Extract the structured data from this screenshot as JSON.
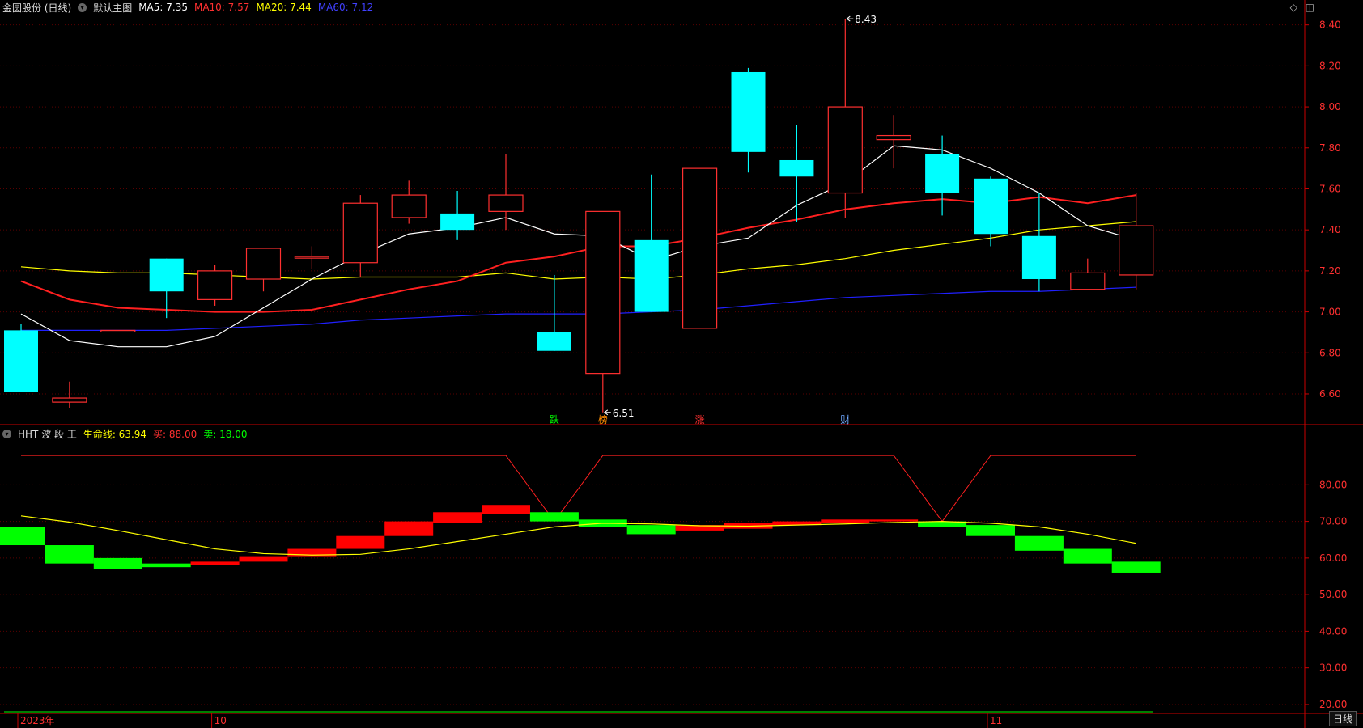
{
  "main_header": {
    "stock": "金圆股份 (日线)",
    "template": "默认主图",
    "ma5": "MA5: 7.35",
    "ma10": "MA10: 7.57",
    "ma20": "MA20: 7.44",
    "ma60": "MA60: 7.12"
  },
  "indicator_header": {
    "name": "HHT 波 段 王",
    "life": "生命线: 63.94",
    "buy": "买: 88.00",
    "sell": "卖: 18.00"
  },
  "colors": {
    "up": "#ff3030",
    "down": "#00ffff",
    "ma5": "#ffffff",
    "ma10": "#ff2020",
    "ma20": "#ffff00",
    "ma60": "#2020ff",
    "axis": "#cc0000",
    "buy_bar": "#ff0000",
    "sell_bar": "#00ff00"
  },
  "window_icons": [
    "diamond-icon",
    "panel-icon"
  ],
  "period_label": "日线",
  "chart_data": [
    {
      "type": "candlestick",
      "title": "金圆股份 (日线)",
      "ylim": [
        6.45,
        8.45
      ],
      "y_ticks": [
        "8.40",
        "8.20",
        "8.00",
        "7.80",
        "7.60",
        "7.40",
        "7.20",
        "7.00",
        "6.80",
        "6.60"
      ],
      "x_labels": [
        {
          "label": "2023年",
          "index": 0
        },
        {
          "label": "10",
          "index": 4
        },
        {
          "label": "11",
          "index": 20
        }
      ],
      "candles": [
        {
          "o": 6.91,
          "c": 6.61,
          "h": 6.94,
          "l": 6.61
        },
        {
          "o": 6.56,
          "c": 6.58,
          "h": 6.66,
          "l": 6.53
        },
        {
          "o": 6.91,
          "c": 6.91,
          "h": 6.91,
          "l": 6.91
        },
        {
          "o": 7.26,
          "c": 7.1,
          "h": 7.26,
          "l": 6.97
        },
        {
          "o": 7.06,
          "c": 7.2,
          "h": 7.23,
          "l": 7.03
        },
        {
          "o": 7.16,
          "c": 7.31,
          "h": 7.31,
          "l": 7.1
        },
        {
          "o": 7.27,
          "c": 7.27,
          "h": 7.32,
          "l": 7.21
        },
        {
          "o": 7.24,
          "c": 7.53,
          "h": 7.57,
          "l": 7.17
        },
        {
          "o": 7.46,
          "c": 7.57,
          "h": 7.64,
          "l": 7.43
        },
        {
          "o": 7.48,
          "c": 7.4,
          "h": 7.59,
          "l": 7.35
        },
        {
          "o": 7.49,
          "c": 7.57,
          "h": 7.77,
          "l": 7.4
        },
        {
          "o": 6.9,
          "c": 6.81,
          "h": 7.18,
          "l": 6.81
        },
        {
          "o": 6.7,
          "c": 7.49,
          "h": 7.49,
          "l": 6.51
        },
        {
          "o": 7.35,
          "c": 7.0,
          "h": 7.67,
          "l": 7.0
        },
        {
          "o": 6.92,
          "c": 7.7,
          "h": 7.7,
          "l": 6.92
        },
        {
          "o": 8.17,
          "c": 7.78,
          "h": 8.19,
          "l": 7.68
        },
        {
          "o": 7.74,
          "c": 7.66,
          "h": 7.91,
          "l": 7.44
        },
        {
          "o": 7.58,
          "c": 8.0,
          "h": 8.43,
          "l": 7.46
        },
        {
          "o": 7.84,
          "c": 7.86,
          "h": 7.96,
          "l": 7.7
        },
        {
          "o": 7.77,
          "c": 7.58,
          "h": 7.86,
          "l": 7.47
        },
        {
          "o": 7.65,
          "c": 7.38,
          "h": 7.66,
          "l": 7.32
        },
        {
          "o": 7.37,
          "c": 7.16,
          "h": 7.58,
          "l": 7.1
        },
        {
          "o": 7.11,
          "c": 7.19,
          "h": 7.26,
          "l": 7.11
        },
        {
          "o": 7.18,
          "c": 7.42,
          "h": 7.58,
          "l": 7.11
        }
      ],
      "ma5": [
        6.99,
        6.86,
        6.83,
        6.83,
        6.88,
        7.02,
        7.16,
        7.28,
        7.38,
        7.41,
        7.46,
        7.38,
        7.37,
        7.25,
        7.32,
        7.36,
        7.52,
        7.63,
        7.81,
        7.79,
        7.7,
        7.58,
        7.42,
        7.35
      ],
      "ma10": [
        7.15,
        7.06,
        7.02,
        7.01,
        7.0,
        7.0,
        7.01,
        7.06,
        7.11,
        7.15,
        7.24,
        7.27,
        7.32,
        7.32,
        7.36,
        7.41,
        7.45,
        7.5,
        7.53,
        7.55,
        7.53,
        7.56,
        7.53,
        7.57
      ],
      "ma20": [
        7.22,
        7.2,
        7.19,
        7.19,
        7.18,
        7.17,
        7.16,
        7.17,
        7.17,
        7.17,
        7.19,
        7.16,
        7.17,
        7.16,
        7.18,
        7.21,
        7.23,
        7.26,
        7.3,
        7.33,
        7.36,
        7.4,
        7.42,
        7.44
      ],
      "ma60": [
        6.91,
        6.91,
        6.91,
        6.91,
        6.92,
        6.93,
        6.94,
        6.96,
        6.97,
        6.98,
        6.99,
        6.99,
        6.99,
        7.0,
        7.01,
        7.03,
        7.05,
        7.07,
        7.08,
        7.09,
        7.1,
        7.1,
        7.11,
        7.12
      ],
      "annotations": [
        {
          "text": "8.43",
          "index": 17,
          "value": 8.43,
          "color": "#ffffff"
        },
        {
          "text": "6.51",
          "index": 12,
          "value": 6.51,
          "color": "#ffffff"
        }
      ],
      "event_markers": [
        {
          "text": "跌",
          "index": 11,
          "color": "#00ff00"
        },
        {
          "text": "榜",
          "index": 12,
          "color": "#ff8c00"
        },
        {
          "text": "涨",
          "index": 14,
          "color": "#ff3030"
        },
        {
          "text": "财",
          "index": 17,
          "color": "#6fa8ff"
        }
      ]
    },
    {
      "type": "indicator",
      "title": "HHT 波 段 王",
      "ylim": [
        18,
        92
      ],
      "y_ticks": [
        "80.00",
        "70.00",
        "60.00",
        "50.00",
        "40.00",
        "30.00",
        "20.00"
      ],
      "life_line": [
        71.5,
        69.8,
        67.5,
        65.0,
        62.5,
        61.2,
        60.8,
        61.0,
        62.5,
        64.5,
        66.5,
        68.5,
        69.5,
        69.3,
        68.8,
        68.7,
        69.0,
        69.3,
        69.7,
        70.0,
        69.5,
        68.5,
        66.5,
        64.0
      ],
      "buy_line": [
        88,
        88,
        88,
        88,
        88,
        88,
        88,
        88,
        88,
        88,
        88,
        70,
        88,
        88,
        88,
        88,
        88,
        88,
        88,
        70,
        88,
        88,
        88,
        88
      ],
      "bars": [
        {
          "color": "sell",
          "top": 68.5,
          "bottom": 63.5
        },
        {
          "color": "sell",
          "top": 63.5,
          "bottom": 58.5
        },
        {
          "color": "sell",
          "top": 60.0,
          "bottom": 57.0
        },
        {
          "color": "sell",
          "top": 58.5,
          "bottom": 57.5
        },
        {
          "color": "buy",
          "top": 59.0,
          "bottom": 58.0
        },
        {
          "color": "buy",
          "top": 60.5,
          "bottom": 59.0
        },
        {
          "color": "buy",
          "top": 62.5,
          "bottom": 60.5
        },
        {
          "color": "buy",
          "top": 66.0,
          "bottom": 62.5
        },
        {
          "color": "buy",
          "top": 70.0,
          "bottom": 66.0
        },
        {
          "color": "buy",
          "top": 72.5,
          "bottom": 69.5
        },
        {
          "color": "buy",
          "top": 74.5,
          "bottom": 72.0
        },
        {
          "color": "sell",
          "top": 72.5,
          "bottom": 70.0
        },
        {
          "color": "sell",
          "top": 70.5,
          "bottom": 68.5
        },
        {
          "color": "sell",
          "top": 69.0,
          "bottom": 66.5
        },
        {
          "color": "buy",
          "top": 69.0,
          "bottom": 67.5
        },
        {
          "color": "buy",
          "top": 69.5,
          "bottom": 68.0
        },
        {
          "color": "buy",
          "top": 70.0,
          "bottom": 69.0
        },
        {
          "color": "buy",
          "top": 70.5,
          "bottom": 69.5
        },
        {
          "color": "buy",
          "top": 70.5,
          "bottom": 70.0
        },
        {
          "color": "sell",
          "top": 70.0,
          "bottom": 68.5
        },
        {
          "color": "sell",
          "top": 69.0,
          "bottom": 66.0
        },
        {
          "color": "sell",
          "top": 66.0,
          "bottom": 62.0
        },
        {
          "color": "sell",
          "top": 62.5,
          "bottom": 58.5
        },
        {
          "color": "sell",
          "top": 59.0,
          "bottom": 56.0
        }
      ],
      "sell_line_value": 18
    }
  ]
}
